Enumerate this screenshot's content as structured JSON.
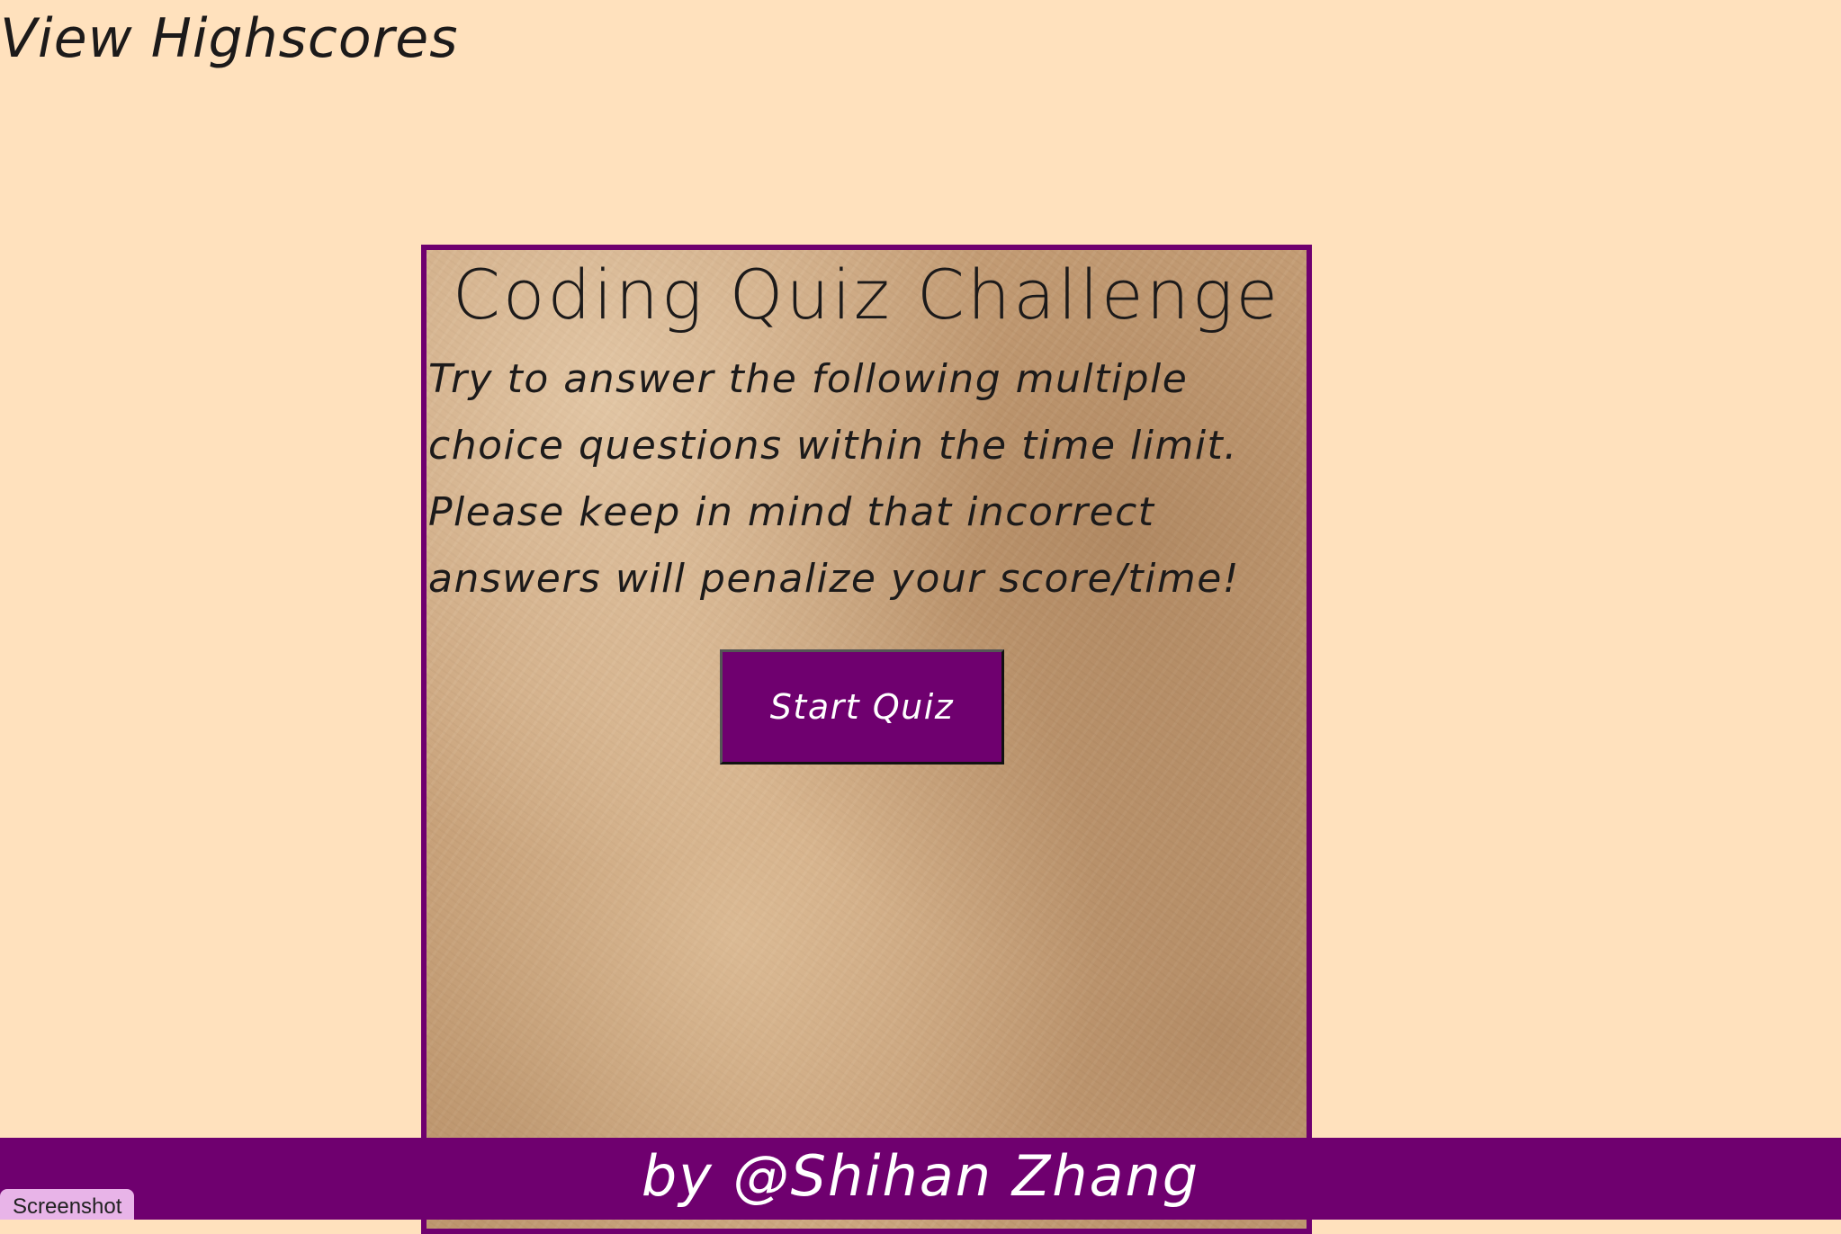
{
  "header": {
    "highscores_link": "View Highscores"
  },
  "quiz": {
    "title": "Coding Quiz Challenge",
    "description": "Try to answer the following multiple choice questions within the time limit. Please keep in mind that incorrect answers will penalize your score/time!",
    "start_button": "Start Quiz"
  },
  "footer": {
    "credit": "by @Shihan Zhang"
  },
  "overlay": {
    "screenshot_tab": "Screenshot"
  },
  "colors": {
    "page_background": "#ffe1bd",
    "accent_purple": "#6f006f",
    "parchment": "#c9a27a",
    "text_dark": "#1c1a1a",
    "text_light": "#ffffff",
    "tab_pink": "#e8b4e8"
  }
}
